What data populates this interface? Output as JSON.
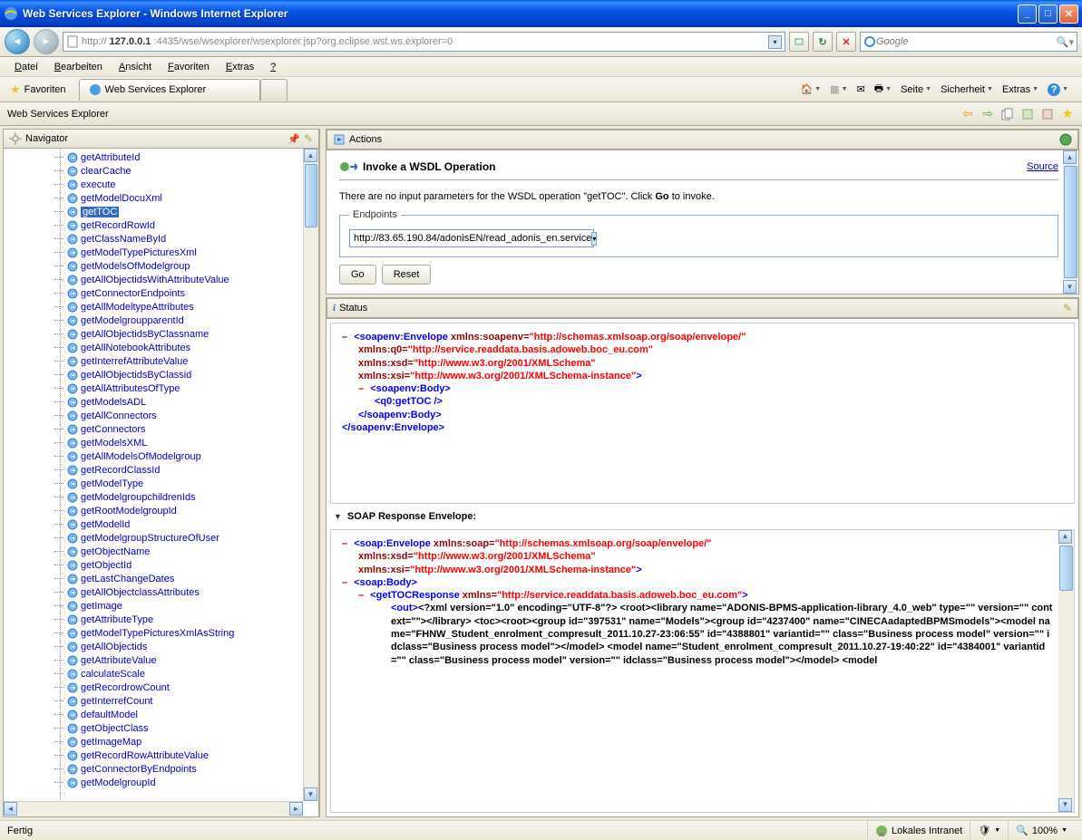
{
  "window": {
    "title": "Web Services Explorer - Windows Internet Explorer"
  },
  "nav": {
    "url_prefix": "http://",
    "url_host": "127.0.0.1",
    "url_rest": ":4435/wse/wsexplorer/wsexplorer.jsp?org.eclipse.wst.ws.explorer=0",
    "search_placeholder": "Google"
  },
  "menubar": {
    "items": [
      "Datei",
      "Bearbeiten",
      "Ansicht",
      "Favoriten",
      "Extras",
      "?"
    ]
  },
  "favbar": {
    "favoriten": "Favoriten",
    "tab_title": "Web Services Explorer"
  },
  "toolbar_right": {
    "seite": "Seite",
    "sicherheit": "Sicherheit",
    "extras": "Extras"
  },
  "app_header": {
    "title": "Web Services Explorer"
  },
  "navigator": {
    "title": "Navigator",
    "items": [
      "getAttributeId",
      "clearCache",
      "execute",
      "getModelDocuXml",
      "getTOC",
      "getRecordRowId",
      "getClassNameById",
      "getModelTypePicturesXml",
      "getModelsOfModelgroup",
      "getAllObjectidsWithAttributeValue",
      "getConnectorEndpoints",
      "getAllModeltypeAttributes",
      "getModelgroupparentId",
      "getAllObjectidsByClassname",
      "getAllNotebookAttributes",
      "getInterrefAttributeValue",
      "getAllObjectidsByClassid",
      "getAllAttributesOfType",
      "getModelsADL",
      "getAllConnectors",
      "getConnectors",
      "getModelsXML",
      "getAllModelsOfModelgroup",
      "getRecordClassId",
      "getModelType",
      "getModelgroupchildrenIds",
      "getRootModelgroupId",
      "getModelId",
      "getModelgroupStructureOfUser",
      "getObjectName",
      "getObjectId",
      "getLastChangeDates",
      "getAllObjectclassAttributes",
      "getImage",
      "getAttributeType",
      "getModelTypePicturesXmlAsString",
      "getAllObjectids",
      "getAttributeValue",
      "calculateScale",
      "getRecordrowCount",
      "getInterrefCount",
      "defaultModel",
      "getObjectClass",
      "getImageMap",
      "getRecordRowAttributeValue",
      "getConnectorByEndpoints",
      "getModelgroupId"
    ],
    "selected_index": 4
  },
  "actions": {
    "title": "Actions",
    "invoke_label": "Invoke a WSDL Operation",
    "source_link": "Source",
    "instruction_pre": "There are no input parameters for the WSDL operation \"getTOC\". Click ",
    "instruction_go": "Go",
    "instruction_post": " to invoke.",
    "endpoints_label": "Endpoints",
    "endpoint_value": "http://83.65.190.84/adonisEN/read_adonis_en.service",
    "go_btn": "Go",
    "reset_btn": "Reset"
  },
  "status": {
    "title": "Status",
    "soap_response_label": "SOAP Response Envelope:"
  },
  "request_xml": {
    "env_open_tag": "<soapenv:Envelope",
    "attr_soapenv_name": " xmlns:soapenv=",
    "attr_soapenv_val": "\"http://schemas.xmlsoap.org/soap/envelope/\"",
    "attr_q0_name": "xmlns:q0=",
    "attr_q0_val": "\"http://service.readdata.basis.adoweb.boc_eu.com\"",
    "attr_xsd_name": "xmlns:xsd=",
    "attr_xsd_val": "\"http://www.w3.org/2001/XMLSchema\"",
    "attr_xsi_name": "xmlns:xsi=",
    "attr_xsi_val": "\"http://www.w3.org/2001/XMLSchema-instance\"",
    "gt": ">",
    "body_open": "<soapenv:Body>",
    "gettoc": "<q0:getTOC />",
    "body_close": "</soapenv:Body>",
    "env_close": "</soapenv:Envelope>"
  },
  "response_xml": {
    "env_open_tag": "<soap:Envelope",
    "attr_soap_name": " xmlns:soap=",
    "attr_soap_val": "\"http://schemas.xmlsoap.org/soap/envelope/\"",
    "attr_xsd_name": "xmlns:xsd=",
    "attr_xsd_val": "\"http://www.w3.org/2001/XMLSchema\"",
    "attr_xsi_name": "xmlns:xsi=",
    "attr_xsi_val": "\"http://www.w3.org/2001/XMLSchema-instance\"",
    "gt": ">",
    "body_open": "<soap:Body>",
    "resp_open_tag": "<getTOCResponse",
    "resp_xmlns_name": " xmlns=",
    "resp_xmlns_val": "\"http://service.readdata.basis.adoweb.boc_eu.com\"",
    "out_open": "<out>",
    "out_text": "<?xml version=\"1.0\" encoding=\"UTF-8\"?> <root><library name=\"ADONIS-BPMS-application-library_4.0_web\" type=\"\" version=\"\" context=\"\"></library> <toc><root><group id=\"397531\" name=\"Models\"><group id=\"4237400\" name=\"CINECAadaptedBPMSmodels\"><model name=\"FHNW_Student_enrolment_compresult_2011.10.27-23:06:55\" id=\"4388801\" variantid=\"\" class=\"Business process model\" version=\"\" idclass=\"Business process model\"></model> <model name=\"Student_enrolment_compresult_2011.10.27-19:40:22\" id=\"4384001\" variantid=\"\" class=\"Business process model\" version=\"\" idclass=\"Business process model\"></model> <model"
  },
  "statusbar": {
    "fertig": "Fertig",
    "intranet": "Lokales Intranet",
    "zoom": "100%"
  }
}
